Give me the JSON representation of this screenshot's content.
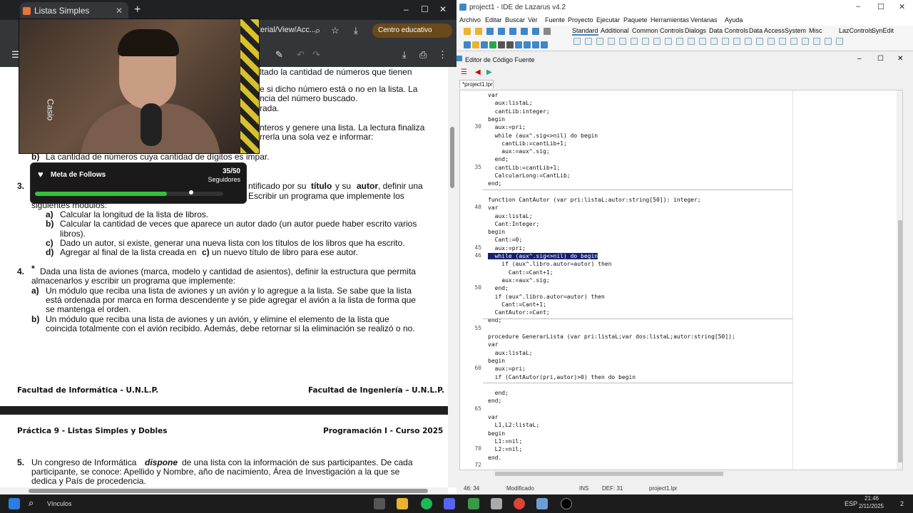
{
  "browser": {
    "tab_title": "Listas Simples",
    "tab_close": "✕",
    "new_tab": "+",
    "url": "terial/View/Acc...",
    "profile": "Centro educativo",
    "win_min": "–",
    "win_max": "☐",
    "win_close": "✕"
  },
  "pdf": {
    "p1_line1": "ltado la cantidad de números que tienen",
    "p1_line2": "e si dicho número está o no en la lista. La",
    "p1_line3": "ncia del número buscado.",
    "p1_line4": "rada.",
    "p2_line1": "nteros y genere una lista. La lectura finaliza",
    "p2_line2": "rrerla una sola vez e informar:",
    "b_label": "b)",
    "b_text": "La cantidad de números cuya cantidad de dígitos es impar.",
    "ex3_num": "3.",
    "ex3_line1_a": "ntificado por su",
    "ex3_titulo": "título",
    "ex3_y": "y su",
    "ex3_autor": "autor",
    "ex3_line1_b": ", definir una",
    "ex3_line2": "Escribir un programa que implemente los",
    "ex3_line3": "siguientes módulos:",
    "a3_label": "a)",
    "a3_text": "Calcular la longitud de la lista de libros.",
    "b3_label": "b)",
    "b3_text1": "Calcular la cantidad de veces que aparece un autor dado (un autor puede haber escrito varios",
    "b3_text2": "libros).",
    "c3_label": "c)",
    "c3_text": "Dado un autor, si existe, generar una nueva lista con los títulos de los libros que ha escrito.",
    "d3_label": "d)",
    "d3_text_a": "Agregar al final de la lista creada en",
    "d3_text_c": "c)",
    "d3_text_b": "un nuevo título de libro para ese autor.",
    "ex4_num": "4.",
    "ex4_star": "*",
    "ex4_line1": "Dada una lista de aviones (marca, modelo y cantidad de asientos), definir la estructura que permita",
    "ex4_line2": "almacenarlos y escribir un programa que implemente:",
    "a4_label": "a)",
    "a4_text1": "Un módulo que reciba una lista de aviones y un avión y lo agregue a la lista. Se sabe que la lista",
    "a4_text2": "está ordenada por marca en forma descendente y se pide agregar el avión a la lista de forma que",
    "a4_text3": "se mantenga el orden.",
    "b4_label": "b)",
    "b4_text1": "Un módulo que reciba una lista de aviones y un avión, y elimine el elemento de la lista que",
    "b4_text2": "coincida totalmente con el avión recibido. Además, debe retornar si la eliminación se realizó o no.",
    "footer_left": "Facultad de Informática - U.N.L.P.",
    "footer_right": "Facultad de Ingeniería – U.N.L.P.",
    "header2_left": "Práctica 9 - Listas Simples y Dobles",
    "header2_right": "Programación I - Curso 2025",
    "ex5_num": "5.",
    "ex5_line1_a": "Un congreso de Informática",
    "ex5_dispone": "dispone",
    "ex5_line1_b": "de una lista con la información de sus participantes. De cada",
    "ex5_line2": "participante, se conoce: Apellido y Nombre, año de nacimiento, Área de Investigación a la que se",
    "ex5_line3": "dedica y País de procedencia."
  },
  "webcam": {
    "side_label": "Casio"
  },
  "follow_goal": {
    "title": "Meta de Follows",
    "count": "35/50",
    "subtitle": "Seguidores",
    "progress": 0.7
  },
  "ide": {
    "title": "project1 - IDE de Lazarus v4.2",
    "menu": [
      "Archivo",
      "Editar",
      "Buscar",
      "Ver",
      "Fuente",
      "Proyecto",
      "Ejecutar",
      "Paquete",
      "Herramientas",
      "Ventanas",
      "Ayuda"
    ],
    "palette_tabs": [
      "Standard",
      "Additional",
      "Common Controls",
      "Dialogs",
      "Data Controls",
      "Data Access",
      "System",
      "Misc",
      "LazControls",
      "SynEdit"
    ],
    "editor_title": "Editor de Código Fuente",
    "file_tab": "*project1.lpr",
    "code": [
      {
        "n": "",
        "t": "var"
      },
      {
        "n": "",
        "t": "  aux:listaL;"
      },
      {
        "n": "",
        "t": "  cantLib:integer;"
      },
      {
        "n": "",
        "t": "begin"
      },
      {
        "n": "30",
        "t": "  aux:=pri;"
      },
      {
        "n": "",
        "t": "  while (aux^.sig<>nil) do begin"
      },
      {
        "n": "",
        "t": "    cantLib:=cantLib+1;"
      },
      {
        "n": "",
        "t": "    aux:=aux^.sig;"
      },
      {
        "n": "",
        "t": "  end;"
      },
      {
        "n": "35",
        "t": "  cantLib:=cantLib+1;"
      },
      {
        "n": "",
        "t": "  CalcularLong:=CantLib;"
      },
      {
        "n": "",
        "t": "end;"
      },
      {
        "n": "",
        "t": ""
      },
      {
        "n": "",
        "t": "function CantAutor (var pri:listaL;autor:string[50]): integer;"
      },
      {
        "n": "40",
        "t": "var"
      },
      {
        "n": "",
        "t": "  aux:listaL;"
      },
      {
        "n": "",
        "t": "  Cant:Integer;"
      },
      {
        "n": "",
        "t": "begin"
      },
      {
        "n": "",
        "t": "  Cant:=0;"
      },
      {
        "n": "45",
        "t": "  aux:=pri;"
      },
      {
        "n": "46",
        "t": "  while (aux^.sig<>nil) do begin"
      },
      {
        "n": "",
        "t": "    if (aux^.libro.autor=autor) then"
      },
      {
        "n": "",
        "t": "      Cant:=Cant+1;"
      },
      {
        "n": "",
        "t": "    aux:=aux^.sig;"
      },
      {
        "n": "50",
        "t": "  end;"
      },
      {
        "n": "",
        "t": "  if (aux^.libro.autor=autor) then"
      },
      {
        "n": "",
        "t": "    Cant:=Cant+1;"
      },
      {
        "n": "",
        "t": "  CantAutor:=Cant;"
      },
      {
        "n": "",
        "t": "end;"
      },
      {
        "n": "55",
        "t": ""
      },
      {
        "n": "",
        "t": "procedure GenerarLista (var pri:listaL;var dos:listaL;autor:string[50]);"
      },
      {
        "n": "",
        "t": "var"
      },
      {
        "n": "",
        "t": "  aux:listaL;"
      },
      {
        "n": "",
        "t": "begin"
      },
      {
        "n": "60",
        "t": "  aux:=pri;"
      },
      {
        "n": "",
        "t": "  if (CantAutor(pri,autor)>0) then do begin"
      },
      {
        "n": "",
        "t": ""
      },
      {
        "n": "",
        "t": "  end;"
      },
      {
        "n": "",
        "t": "end;"
      },
      {
        "n": "65",
        "t": ""
      },
      {
        "n": "",
        "t": "var"
      },
      {
        "n": "",
        "t": "  L1,L2:listaL;"
      },
      {
        "n": "",
        "t": "begin"
      },
      {
        "n": "",
        "t": "  L1:=nil;"
      },
      {
        "n": "70",
        "t": "  L2:=nil;"
      },
      {
        "n": "",
        "t": "end."
      },
      {
        "n": "72",
        "t": ""
      }
    ],
    "status_pos": "46: 34",
    "status_mod": "Modificado",
    "status_ins": "INS",
    "status_def": "DEF: 31",
    "status_file": "project1.lpr"
  },
  "taskbar": {
    "search_label": "Vínculos",
    "lang": "ESP",
    "time": "21:46",
    "date": "2/11/2025",
    "notif": "2"
  }
}
